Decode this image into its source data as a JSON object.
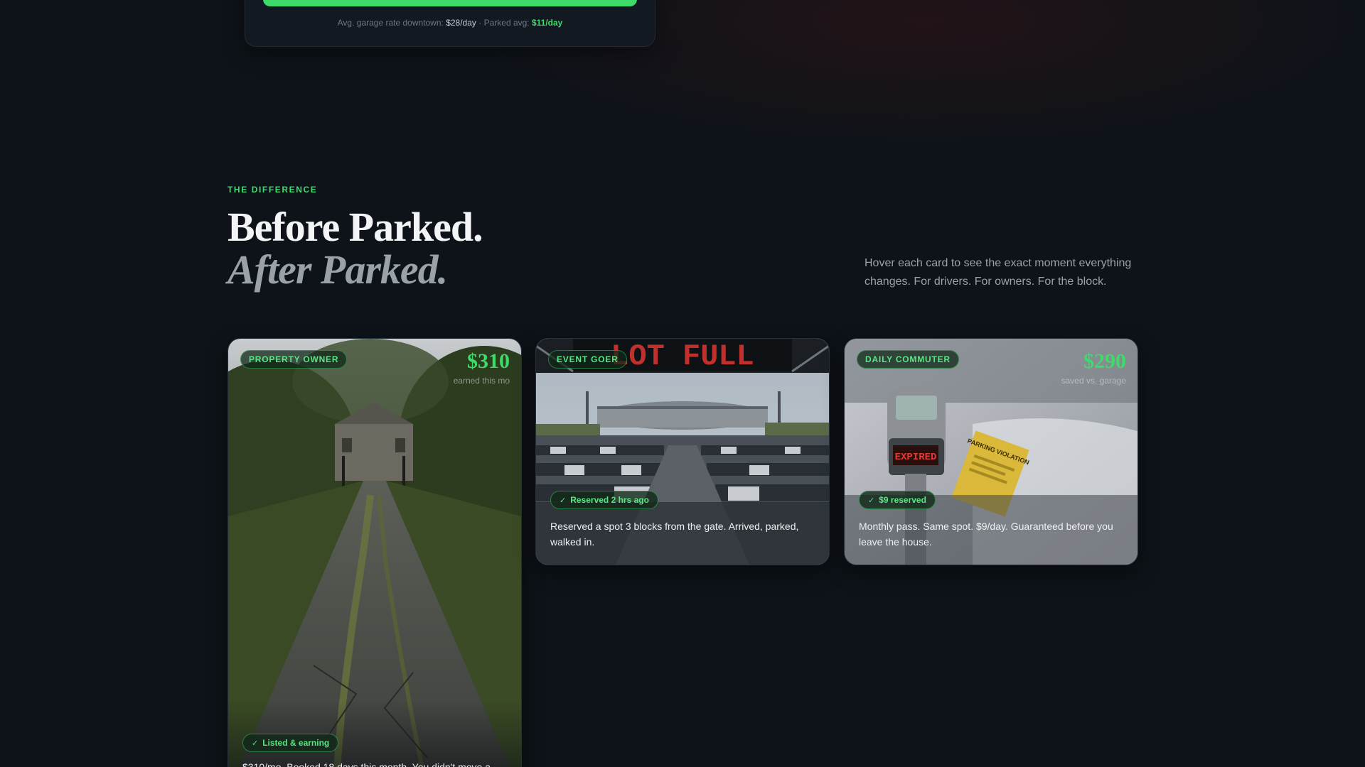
{
  "calculator": {
    "note_prefix": "Avg. garage rate downtown:",
    "garage_rate": "$28/day",
    "separator": "·",
    "parked_prefix": "Parked avg:",
    "parked_rate": "$11/day"
  },
  "section": {
    "eyebrow": "THE DIFFERENCE",
    "title_line1": "Before Parked.",
    "title_line2": "After Parked.",
    "intro": "Hover each card to see the exact moment everything changes. For drivers. For owners. For the block."
  },
  "cards": [
    {
      "tag": "PROPERTY OWNER",
      "amount": "$310",
      "amount_sub": "earned this mo",
      "status": "Listed & earning",
      "desc": "$310/mo. Booked 18 days this month. You didn't move a"
    },
    {
      "tag": "EVENT GOER",
      "amount": "",
      "amount_sub": "",
      "status": "Reserved 2 hrs ago",
      "desc": "Reserved a spot 3 blocks from the gate. Arrived, parked, walked in.",
      "sign_text": "LOT FULL"
    },
    {
      "tag": "DAILY COMMUTER",
      "amount": "$290",
      "amount_sub": "saved vs. garage",
      "status": "$9 reserved",
      "desc": "Monthly pass. Same spot. $9/day. Guaranteed before you leave the house.",
      "meter_text": "EXPIRED",
      "ticket_text": "PARKING VIOLATION"
    }
  ],
  "colors": {
    "accent": "#3ddc6a",
    "background": "#0e1319"
  },
  "icons": {
    "status": "check-icon"
  }
}
